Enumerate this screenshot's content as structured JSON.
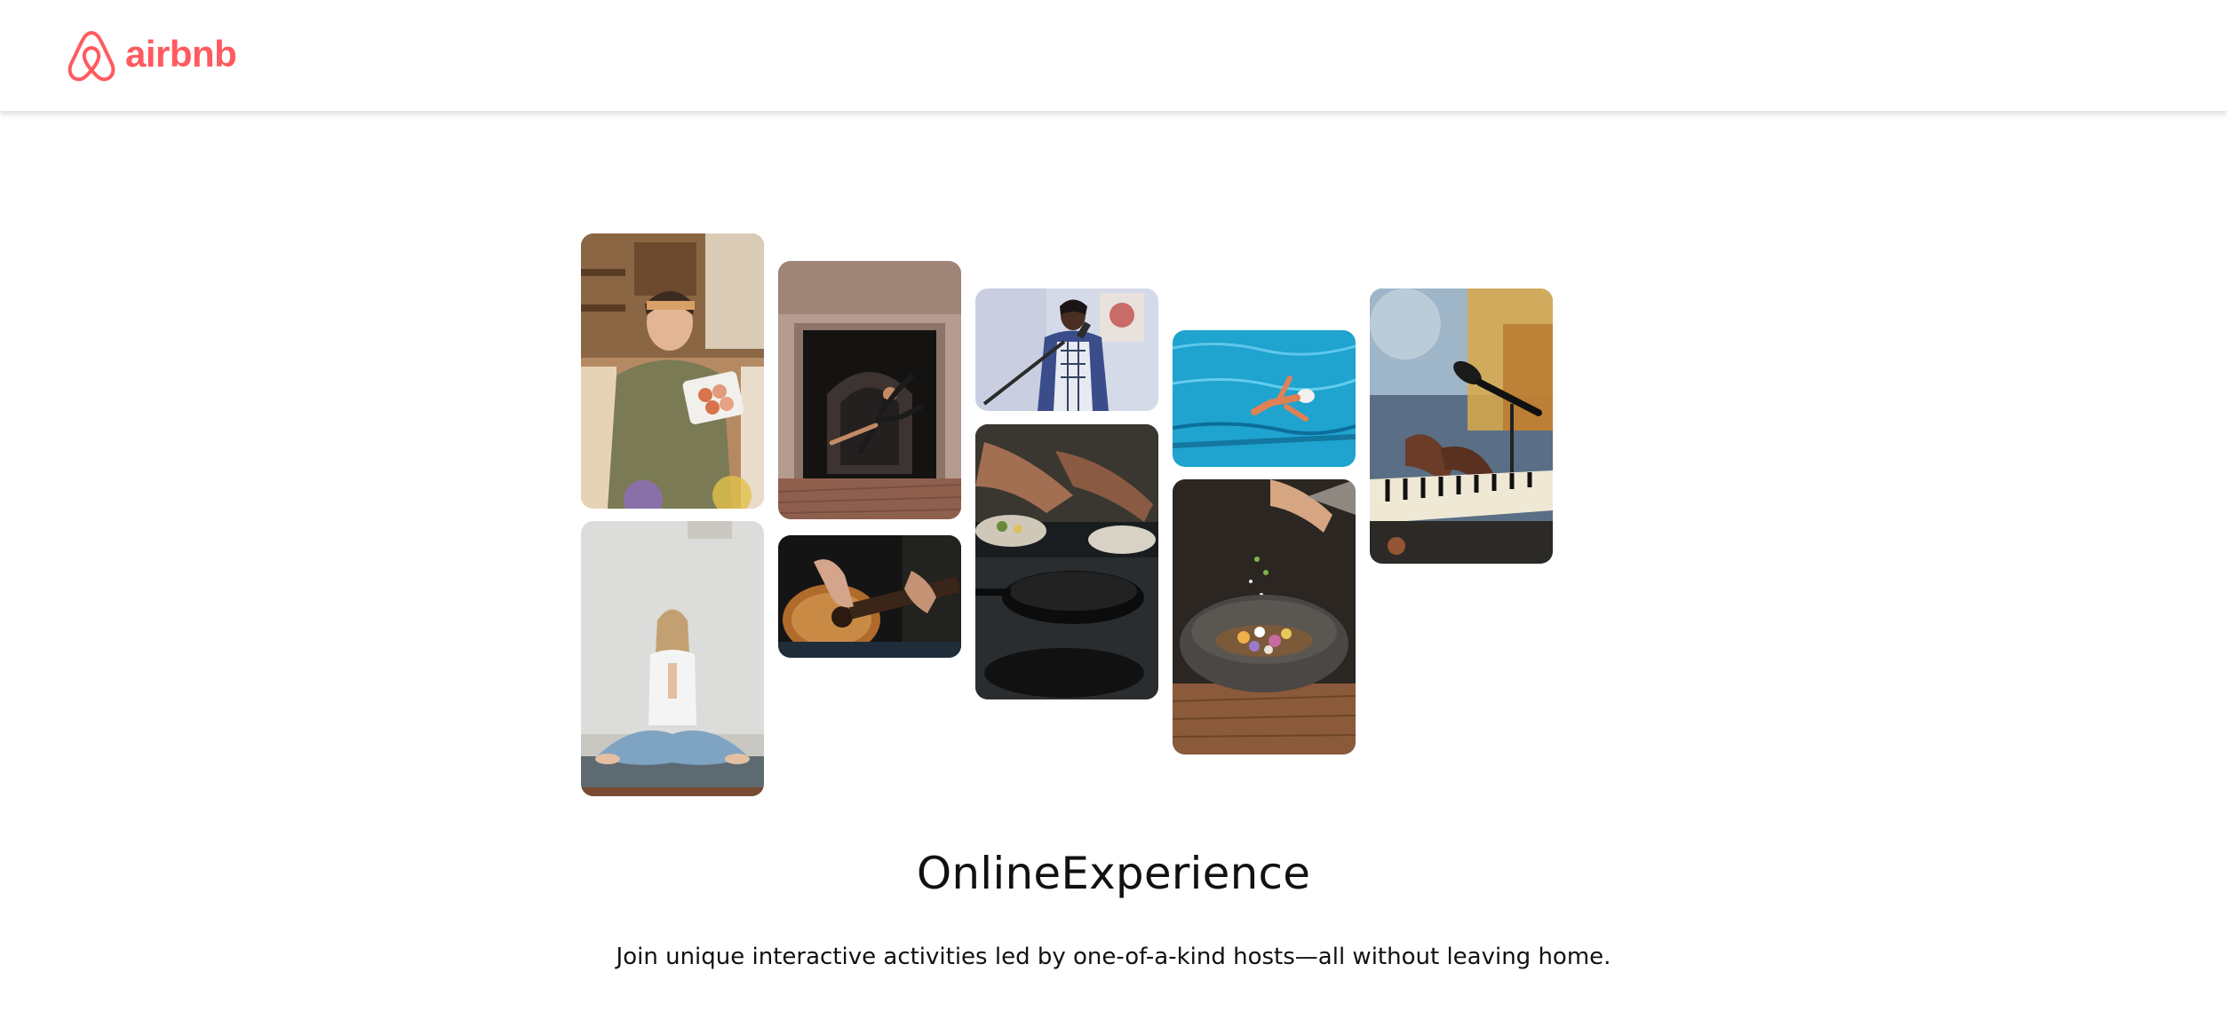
{
  "header": {
    "logo_text": "airbnb",
    "logo_icon": "airbnb-belo-icon",
    "brand_color": "#ff5a5f"
  },
  "gallery": {
    "photos": [
      {
        "name": "photo-baker",
        "subject": "woman-holding-macarons"
      },
      {
        "name": "photo-yoga",
        "subject": "woman-meditating"
      },
      {
        "name": "photo-dancer",
        "subject": "dancer-leaping-in-archway"
      },
      {
        "name": "photo-guitar",
        "subject": "acoustic-guitar-playing"
      },
      {
        "name": "photo-singer",
        "subject": "man-singing-into-mic"
      },
      {
        "name": "photo-cooking",
        "subject": "hands-cooking-with-pan"
      },
      {
        "name": "photo-swim",
        "subject": "swimmer-in-pool"
      },
      {
        "name": "photo-food",
        "subject": "seasoning-bowl-of-food"
      },
      {
        "name": "photo-piano",
        "subject": "hands-on-keyboard-with-mic"
      }
    ]
  },
  "hero": {
    "title": "OnlineExperience",
    "subtitle": "Join unique interactive activities led by one-of-a-kind hosts—all without leaving home."
  }
}
